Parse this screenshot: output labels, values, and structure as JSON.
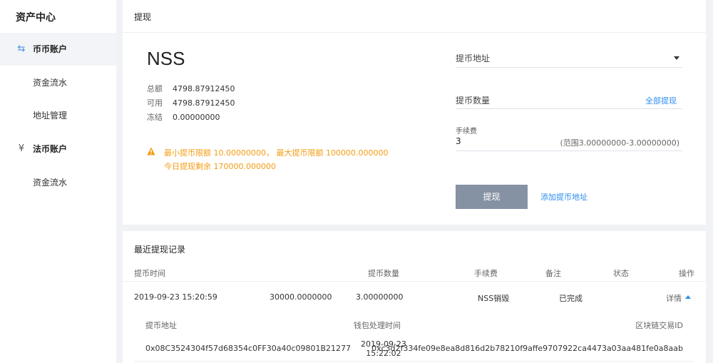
{
  "sidebar": {
    "title": "资产中心",
    "items": [
      {
        "label": "币币账户",
        "icon": "exchange-icon"
      },
      {
        "label": "资金流水"
      },
      {
        "label": "地址管理"
      },
      {
        "label": "法币账户",
        "icon": "yen-icon"
      },
      {
        "label": "资金流水"
      }
    ]
  },
  "withdraw": {
    "title": "提现",
    "coin": "NSS",
    "balances": [
      {
        "label": "总额",
        "value": "4798.87912450"
      },
      {
        "label": "可用",
        "value": "4798.87912450"
      },
      {
        "label": "冻结",
        "value": "0.00000000"
      }
    ],
    "notice_line1": "最小提币限额 10.00000000， 最大提币限额 100000.000000",
    "notice_line2": "今日提现剩余 170000.000000",
    "address_placeholder": "提币地址",
    "amount_placeholder": "提币数量",
    "withdraw_all": "全部提现",
    "fee_label": "手续费",
    "fee_value": "3",
    "fee_range": "(范围3.00000000-3.00000000)",
    "submit_label": "提现",
    "add_address": "添加提币地址"
  },
  "records": {
    "title": "最近提现记录",
    "columns": [
      "提币时间",
      "提币数量",
      "手续费",
      "备注",
      "状态",
      "操作"
    ],
    "row": {
      "time": "2019-09-23 15:20:59",
      "amount": "30000.0000000",
      "fee": "3.00000000",
      "remark": "NSS销毁",
      "status": "已完成",
      "action": "详情"
    },
    "detail": {
      "columns": [
        "提币地址",
        "钱包处理时间",
        "区块链交易ID"
      ],
      "address": "0x08C3524304f57d68354c0FF30a40c09801B21277",
      "wallet_date": "2019-09-23",
      "wallet_time": "15:22:02",
      "txid": "0xc3d2f334fe09e8ea8d816d2b78210f9affe9707922ca4473a03aa481fe0a8aab"
    }
  },
  "colors": {
    "accent": "#2d8cf0",
    "warning": "#f39c12",
    "button": "#8592a4"
  }
}
